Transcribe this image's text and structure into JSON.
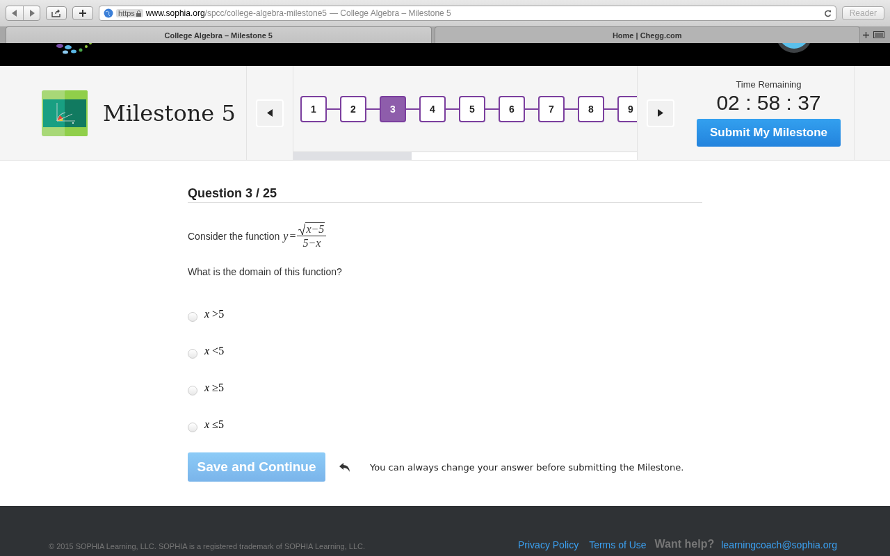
{
  "browser": {
    "url_scheme": "https",
    "url_host": "www.sophia.org",
    "url_path": "/spcc/college-algebra-milestone5",
    "url_title": " — College Algebra – Milestone 5",
    "reader": "Reader",
    "tabs": [
      {
        "label": "College Algebra – Milestone 5",
        "selected": true
      },
      {
        "label": "Home | Chegg.com",
        "selected": false
      }
    ]
  },
  "header": {
    "title": "Milestone 5",
    "steps": [
      {
        "label": "1",
        "selected": false
      },
      {
        "label": "2",
        "selected": false
      },
      {
        "label": "3",
        "selected": true
      },
      {
        "label": "4",
        "selected": false
      },
      {
        "label": "5",
        "selected": false
      },
      {
        "label": "6",
        "selected": false
      },
      {
        "label": "7",
        "selected": false
      },
      {
        "label": "8",
        "selected": false
      },
      {
        "label": "9",
        "selected": false
      }
    ],
    "timer_label": "Time Remaining",
    "time": "02 : 58 : 37",
    "submit": "Submit My Milestone"
  },
  "question": {
    "heading": "Question 3 / 25",
    "prompt": "Consider the function",
    "formula": {
      "lhs": "y",
      "relation": "=",
      "numerator": "x−5",
      "denominator": "5−x"
    },
    "text": "What is the domain of this function?",
    "options": [
      {
        "label": "*x* >5",
        "selected": false
      },
      {
        "label": "*x* <5",
        "selected": false
      },
      {
        "label": "*x* ≥5",
        "selected": false
      },
      {
        "label": "*x* ≤5",
        "selected": false
      }
    ],
    "save": {
      "label": "Save and Continue",
      "disabled": true
    },
    "hint": "You can always change your answer before submitting the Milestone."
  },
  "footer": {
    "copyright": "© 2015 SOPHIA Learning, LLC. SOPHIA is a registered trademark of SOPHIA Learning, LLC.",
    "links": [
      "Privacy Policy",
      "Terms of Use"
    ],
    "help": "Want help?",
    "email": "learningcoach@sophia.org"
  }
}
